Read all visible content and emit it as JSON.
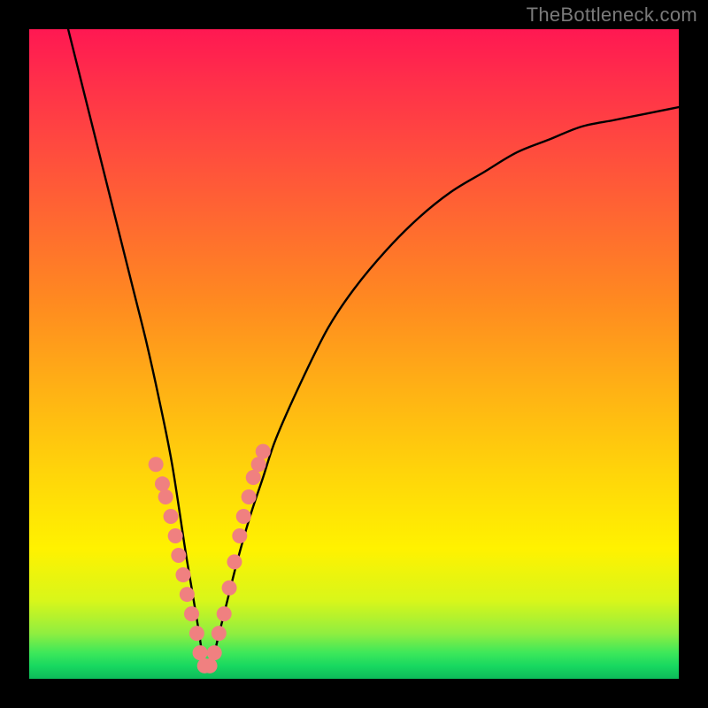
{
  "watermark": "TheBottleneck.com",
  "chart_data": {
    "type": "line",
    "title": "",
    "xlabel": "",
    "ylabel": "",
    "xlim": [
      0,
      100
    ],
    "ylim": [
      0,
      100
    ],
    "note": "V-shaped curve; values read off image as approximate percentages of plot height (0 = bottom/green, 100 = top/red). Minimum of curve is near x≈27.",
    "series": [
      {
        "name": "curve",
        "x": [
          6,
          8,
          10,
          12,
          14,
          16,
          18,
          20,
          22,
          24,
          25,
          26,
          27,
          28,
          29,
          30,
          32,
          34,
          36,
          38,
          42,
          46,
          50,
          55,
          60,
          65,
          70,
          75,
          80,
          85,
          90,
          95,
          100
        ],
        "y": [
          100,
          92,
          84,
          76,
          68,
          60,
          52,
          43,
          33,
          20,
          14,
          8,
          2,
          2,
          6,
          10,
          18,
          25,
          31,
          37,
          46,
          54,
          60,
          66,
          71,
          75,
          78,
          81,
          83,
          85,
          86,
          87,
          88
        ]
      }
    ],
    "markers": {
      "note": "Pink rounded dots along lower portion of V (approx bottleneck zone)",
      "color": "#f08080",
      "points_x": [
        19.5,
        20.5,
        21.0,
        21.8,
        22.5,
        23.0,
        23.7,
        24.3,
        25.0,
        25.8,
        26.3,
        27.0,
        27.8,
        28.5,
        29.2,
        30.0,
        30.8,
        31.6,
        32.4,
        33.0,
        33.8,
        34.5,
        35.3,
        36.0
      ],
      "points_y": [
        33,
        30,
        28,
        25,
        22,
        19,
        16,
        13,
        10,
        7,
        4,
        2,
        2,
        4,
        7,
        10,
        14,
        18,
        22,
        25,
        28,
        31,
        33,
        35
      ]
    }
  }
}
